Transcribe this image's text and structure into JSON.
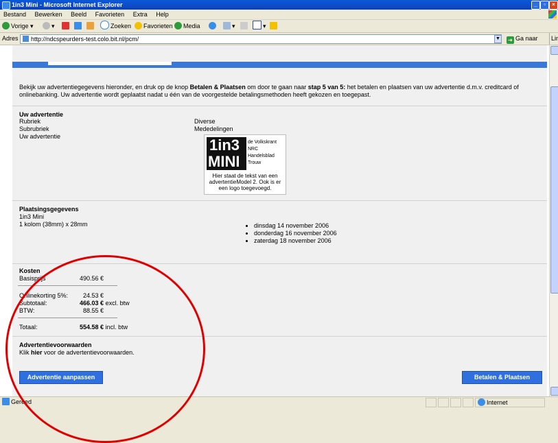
{
  "window": {
    "title": "1in3 Mini - Microsoft Internet Explorer"
  },
  "menu": [
    "Bestand",
    "Bewerken",
    "Beeld",
    "Favorieten",
    "Extra",
    "Help"
  ],
  "toolbar": {
    "back": "Vorige",
    "search": "Zoeken",
    "favorites": "Favorieten",
    "media": "Media"
  },
  "address": {
    "label": "Adres",
    "url": "http://ndcspeurders-test.colo.bit.nl/pcm/",
    "go": "Ga naar",
    "links": "Links"
  },
  "intro": {
    "pre": "Bekijk uw advertentiegegevens hieronder, en druk op de knop ",
    "bold1": "Betalen & Plaatsen",
    "mid": " om door te gaan naar ",
    "bold2": "stap 5 van 5:",
    "post": " het betalen en plaatsen van uw advertentie d.m.v. creditcard of onlinebanking. Uw advertentie wordt geplaatst nadat u één van de voorgestelde betalingsmethoden heeft gekozen en toegepast."
  },
  "ad": {
    "heading": "Uw advertentie",
    "rubriek_label": "Rubriek",
    "rubriek_value": "Diverse",
    "subrubriek_label": "Subrubriek",
    "subrubriek_value": "Mededelingen",
    "ad_label": "Uw advertentie",
    "logo_line1": "1in3",
    "logo_line2": "MINI",
    "papers": [
      "de Volkskrant",
      "NRC Handelsblad",
      "Trouw"
    ],
    "caption": "Hier staat de tekst van een advertentieModel 2. Ook is er een logo toegevoegd."
  },
  "placement": {
    "heading": "Plaatsingsgegevens",
    "product": "1in3 Mini",
    "size": "1 kolom (38mm) x 28mm",
    "dates": [
      "dinsdag 14 november 2006",
      "donderdag 16 november 2006",
      "zaterdag 18 november 2006"
    ]
  },
  "costs": {
    "heading": "Kosten",
    "basis_label": "Basisprijs",
    "basis_value": "490.56 €",
    "korting_label": "Onlinekorting 5%:",
    "korting_value": "24.53 €",
    "subtotaal_label": "Subtotaal:",
    "subtotaal_value": "466.03 €",
    "subtotaal_note": "excl. btw",
    "btw_label": "BTW:",
    "btw_value": "88.55 €",
    "totaal_label": "Totaal:",
    "totaal_value": "554.58 €",
    "totaal_note": "incl. btw"
  },
  "terms": {
    "heading": "Advertentievoorwaarden",
    "pre": "Klik ",
    "link": "hier",
    "post": " voor de advertentievoorwaarden."
  },
  "buttons": {
    "edit": "Advertentie aanpassen",
    "pay": "Betalen & Plaatsen"
  },
  "status": {
    "text": "Gereed",
    "zone": "Internet"
  },
  "colors": {
    "accent": "#2f6fe0",
    "annotation": "#e00000"
  }
}
